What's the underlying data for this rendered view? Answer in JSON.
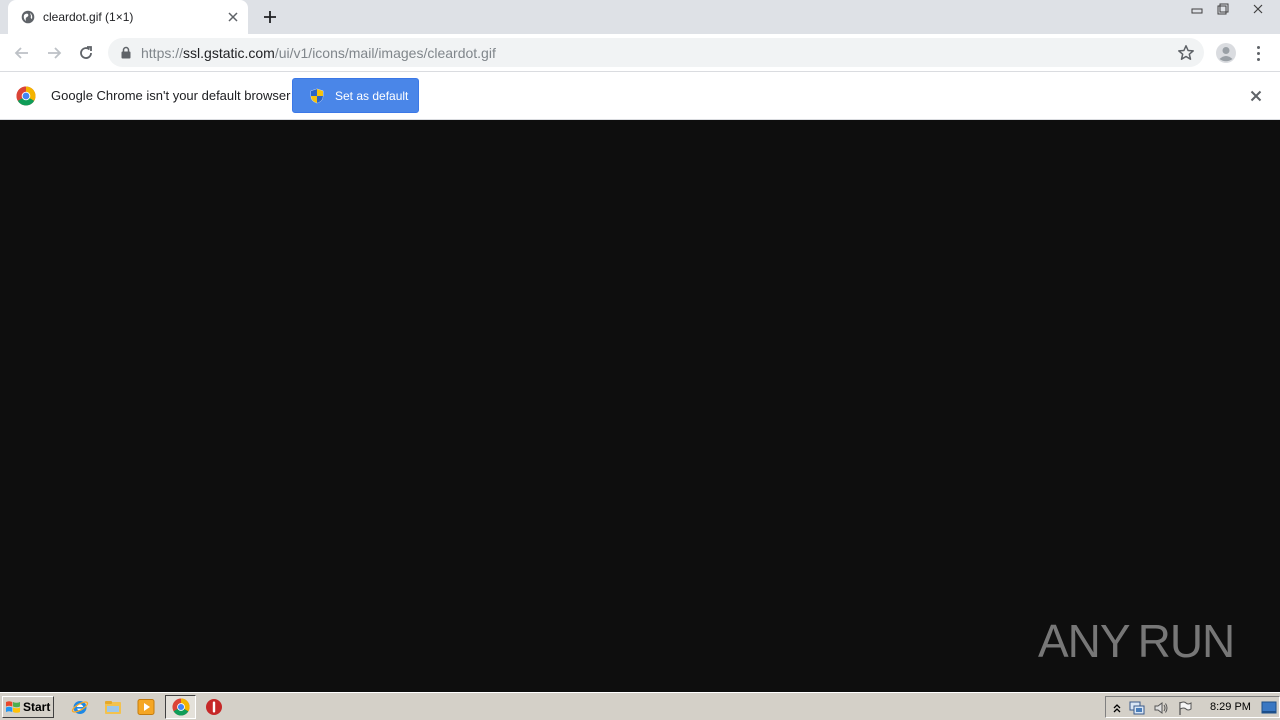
{
  "tab": {
    "title": "cleardot.gif (1×1)"
  },
  "address": {
    "scheme": "https://",
    "host": "ssl.gstatic.com",
    "path": "/ui/v1/icons/mail/images/cleardot.gif"
  },
  "infobar": {
    "message": "Google Chrome isn't your default browser",
    "button_label": "Set as default"
  },
  "watermark": {
    "left": "ANY",
    "right": "RUN"
  },
  "taskbar": {
    "start_label": "Start",
    "clock": "8:29 PM"
  },
  "colors": {
    "content_bg": "#0e0e0e",
    "button_blue": "#4a86e8",
    "tabstrip": "#dee1e6",
    "taskbar": "#d4d0c8"
  }
}
